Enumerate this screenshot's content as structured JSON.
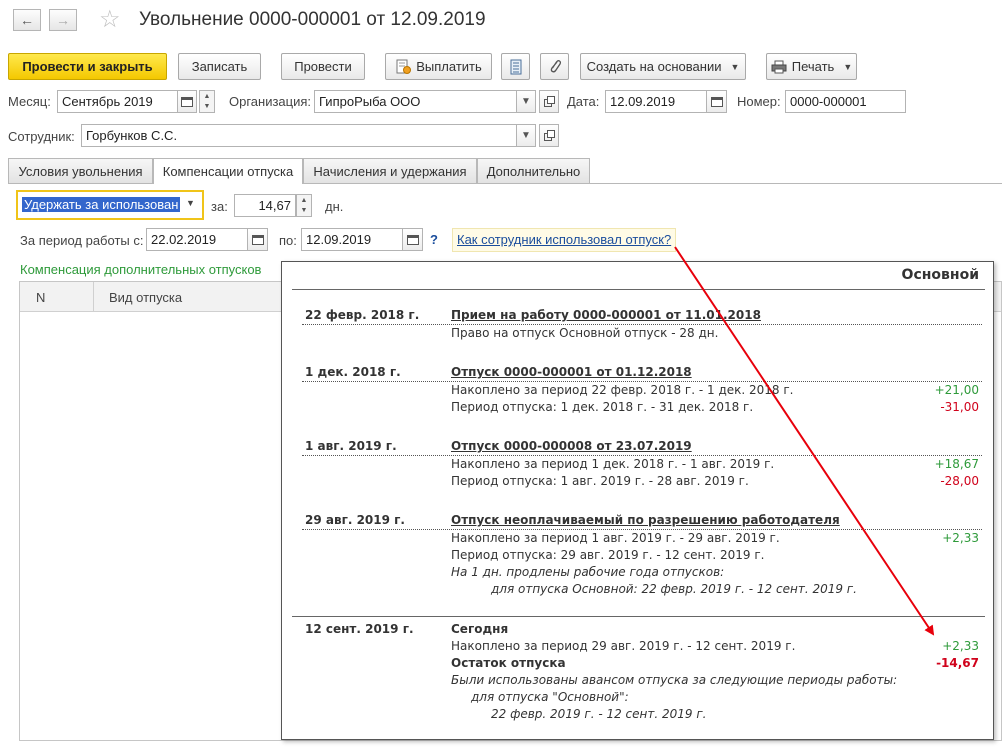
{
  "window": {
    "title": "Увольнение 0000-000001 от 12.09.2019",
    "back_icon": "←",
    "forward_icon": "→",
    "star_icon": "☆"
  },
  "toolbar": {
    "post_close": "Провести и закрыть",
    "save": "Записать",
    "post": "Провести",
    "pay": "Выплатить",
    "create_based": "Создать на основании",
    "print": "Печать"
  },
  "form": {
    "month_label": "Месяц:",
    "month_value": "Сентябрь 2019",
    "org_label": "Организация:",
    "org_value": "ГипроРыба ООО",
    "date_label": "Дата:",
    "date_value": "12.09.2019",
    "number_label": "Номер:",
    "number_value": "0000-000001",
    "employee_label": "Сотрудник:",
    "employee_value": "Горбунков С.С."
  },
  "tabs": [
    {
      "label": "Условия увольнения"
    },
    {
      "label": "Компенсации отпуска"
    },
    {
      "label": "Начисления и удержания"
    },
    {
      "label": "Дополнительно"
    }
  ],
  "compensation": {
    "mode_value": "Удержать за использован",
    "for_label": "за:",
    "days_value": "14,67",
    "days_unit": "дн.",
    "period_from_label": "За период работы с:",
    "period_from_value": "22.02.2019",
    "period_to_label": "по:",
    "period_to_value": "12.09.2019",
    "help_q": "?",
    "help_link": "Как сотрудник использовал отпуск?",
    "additional_title": "Компенсация дополнительных отпусков",
    "col_n": "N",
    "col_kind": "Вид отпуска"
  },
  "popup": {
    "header": "Основной",
    "entries": [
      {
        "date": "22 февр. 2018 г.",
        "title": "Прием на работу 0000-000001 от 11.01.2018",
        "lines": [
          {
            "text": "Право на отпуск Основной отпуск - 28 дн.",
            "amount": ""
          }
        ]
      },
      {
        "date": "1 дек. 2018 г.",
        "title": "Отпуск 0000-000001 от 01.12.2018",
        "lines": [
          {
            "text": "Накоплено за период 22 февр. 2018 г. - 1 дек. 2018 г.",
            "amount": "+21,00"
          },
          {
            "text": "Период отпуска: 1 дек. 2018 г. - 31 дек. 2018 г.",
            "amount": "-31,00"
          }
        ]
      },
      {
        "date": "1 авг. 2019 г.",
        "title": "Отпуск 0000-000008 от 23.07.2019",
        "lines": [
          {
            "text": "Накоплено за период 1 дек. 2018 г. - 1 авг. 2019 г.",
            "amount": "+18,67"
          },
          {
            "text": "Период отпуска: 1 авг. 2019 г. - 28 авг. 2019 г.",
            "amount": "-28,00"
          }
        ]
      },
      {
        "date": "29 авг. 2019 г.",
        "title": "Отпуск неоплачиваемый по разрешению работодателя",
        "lines": [
          {
            "text": "Накоплено за период 1 авг. 2019 г. - 29 авг. 2019 г.",
            "amount": "+2,33"
          },
          {
            "text": "Период отпуска: 29 авг. 2019 г. - 12 сент. 2019 г.",
            "amount": ""
          }
        ],
        "note1": "На 1 дн. продлены рабочие года отпусков:",
        "note2": "для отпуска Основной: 22 февр. 2019 г. - 12 сент. 2019 г."
      }
    ],
    "today": {
      "date": "12 сент. 2019 г.",
      "title": "Сегодня",
      "accrued_text": "Накоплено за период 29 авг. 2019 г. - 12 сент. 2019 г.",
      "accrued_amount": "+2,33",
      "balance_text": "Остаток отпуска",
      "balance_amount": "-14,67",
      "note1": "Были использованы авансом отпуска за следующие периоды работы:",
      "note2": "для отпуска \"Основной\":",
      "note3": "22 февр. 2019 г. - 12 сент. 2019 г."
    }
  },
  "colors": {
    "accent_yellow": "#f4c800",
    "positive": "#2e9a3a",
    "negative": "#d0021b",
    "annotation_arrow": "#e8000b",
    "section_green": "#2e9a3a",
    "link_blue": "#1a4d9c"
  }
}
